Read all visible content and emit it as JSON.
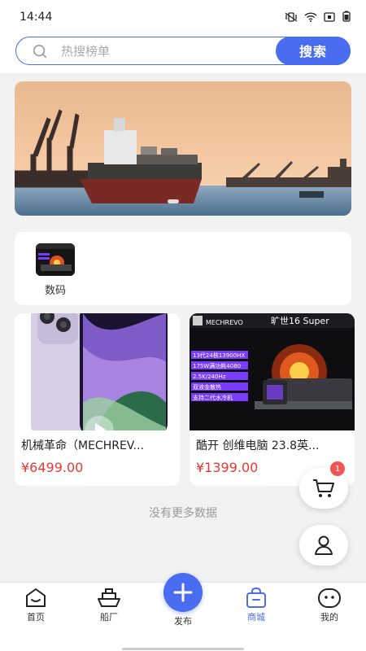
{
  "status_bar": {
    "time": "14:44"
  },
  "search": {
    "placeholder": "热搜榜单",
    "button_label": "搜索"
  },
  "categories": [
    {
      "label": "数码"
    }
  ],
  "products": [
    {
      "title": "机械革命（MECHREV...",
      "price": "¥6499.00"
    },
    {
      "title": "酷开 创维电脑 23.8英...",
      "price": "¥1399.00",
      "banner_brand": "MECHREVO",
      "banner_model": "旷世16 Super",
      "specs": [
        "13代24核13900HX",
        "175W满功耗4080",
        "2.5K/240Hz",
        "双液金散热",
        "支持二代水冷机"
      ]
    }
  ],
  "footer_text": "没有更多数据",
  "cart_badge": "1",
  "tabs": [
    {
      "label": "首页"
    },
    {
      "label": "船厂"
    },
    {
      "label": "发布"
    },
    {
      "label": "商城"
    },
    {
      "label": "我的"
    }
  ],
  "colors": {
    "accent": "#4a6cf0",
    "price": "#e53935",
    "badge": "#f05454"
  }
}
